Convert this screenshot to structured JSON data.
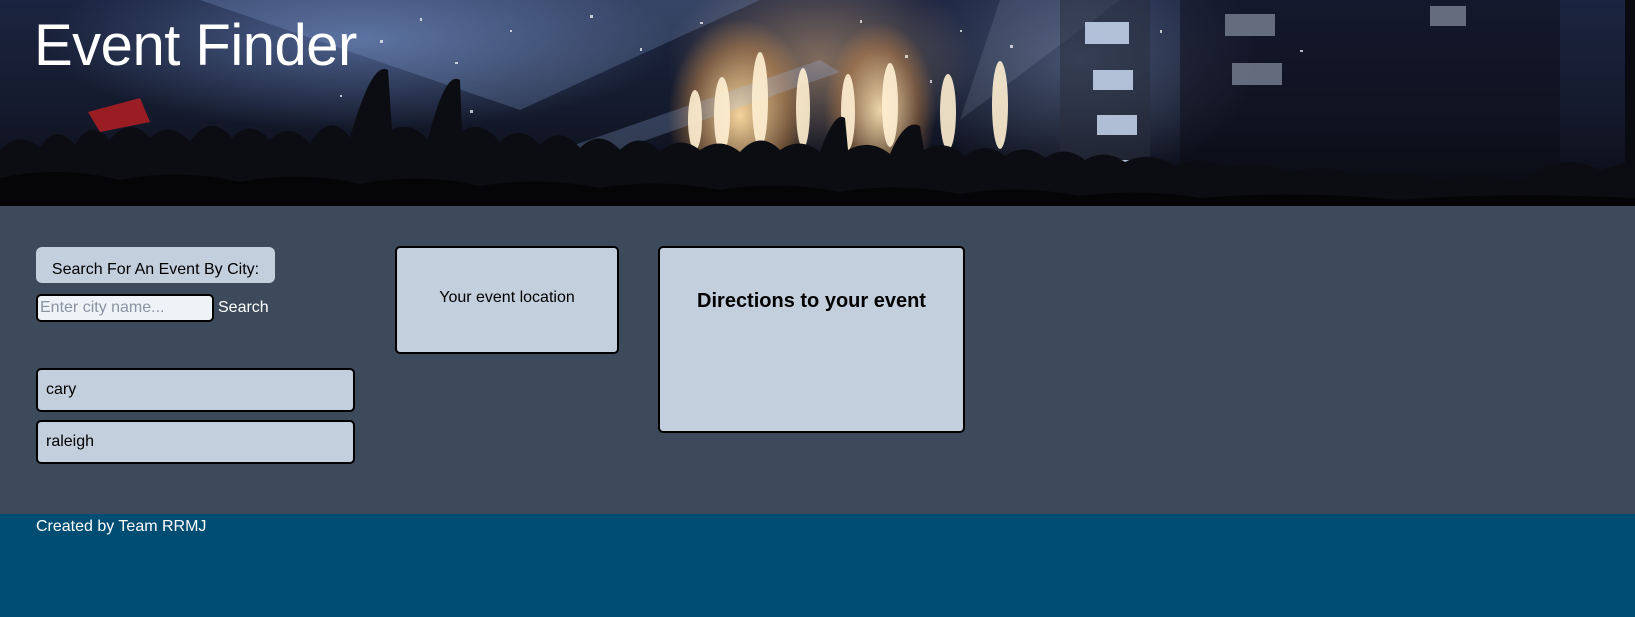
{
  "header": {
    "title": "Event Finder",
    "background_image": "concert-crowd-with-pyrotechnics"
  },
  "search": {
    "label": "Search For An Event By City:",
    "placeholder": "Enter city name...",
    "value": "",
    "button_label": "Search"
  },
  "history": {
    "items": [
      {
        "label": "cary"
      },
      {
        "label": "raleigh"
      }
    ]
  },
  "location": {
    "text": "Your event location"
  },
  "directions": {
    "title": "Directions to your event"
  },
  "footer": {
    "text": "Created by Team RRMJ"
  },
  "colors": {
    "main_background": "#3d4a5c",
    "panel_background": "#c4cfdd",
    "footer_background": "#004d73",
    "text_light": "#ffffff"
  }
}
